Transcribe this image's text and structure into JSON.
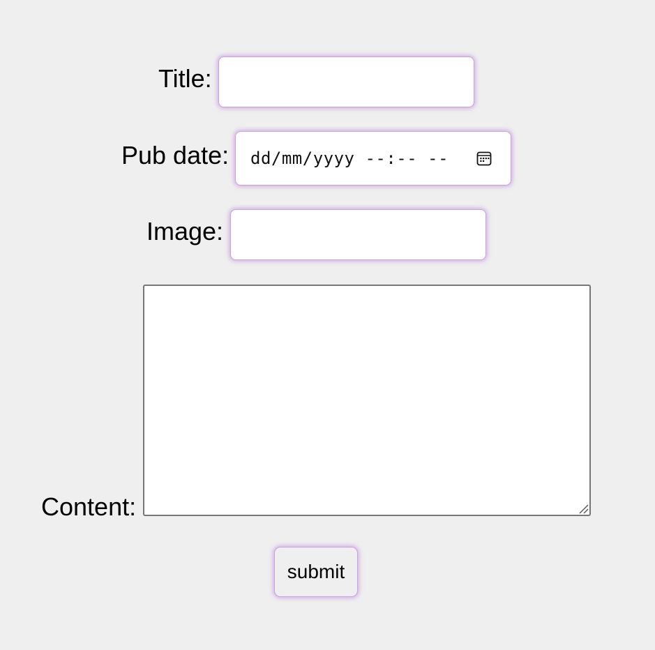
{
  "form": {
    "title_label": "Title:",
    "title_value": "",
    "pubdate_label": "Pub date:",
    "pubdate_placeholder": "dd/mm/yyyy --:-- --",
    "image_label": "Image:",
    "image_value": "",
    "content_label": "Content:",
    "content_value": "",
    "submit_label": "submit"
  },
  "icons": {
    "calendar": "calendar-icon",
    "resize": "resize-grip-icon"
  },
  "colors": {
    "background": "#efefef",
    "focus_glow": "#c9a2e0",
    "field_background": "#ffffff",
    "textarea_border": "#767676"
  }
}
